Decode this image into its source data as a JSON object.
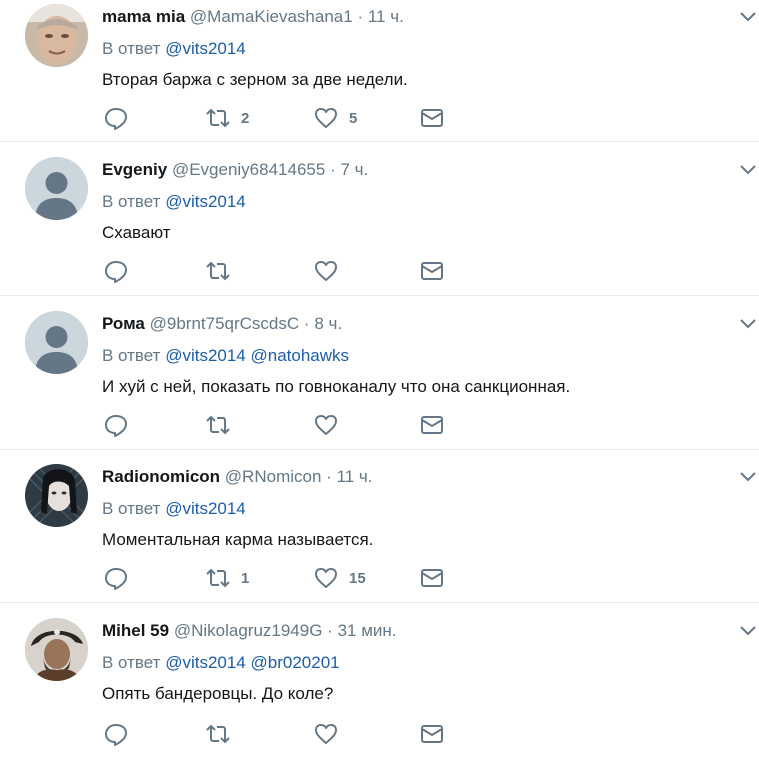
{
  "colors": {
    "name": "#14171a",
    "meta": "#657786",
    "mention": "#1b5ea8",
    "divider": "#e6ecf0",
    "icon": "#657786",
    "avatar_default": "#ccd6dd"
  },
  "tweets": [
    {
      "name": "mama mia",
      "handle": "@MamaKievashana1",
      "dot": "·",
      "time": "11 ч.",
      "reply_prefix": "В ответ",
      "mentions": [
        "@vits2014"
      ],
      "text": "Вторая баржа с зерном за две недели.",
      "retweets": "2",
      "likes": "5",
      "avatar": "photo-man-face"
    },
    {
      "name": "Evgeniy",
      "handle": "@Evgeniy68414655",
      "dot": "·",
      "time": "7 ч.",
      "reply_prefix": "В ответ",
      "mentions": [
        "@vits2014"
      ],
      "text": "Схавают",
      "retweets": "",
      "likes": "",
      "avatar": "default-person"
    },
    {
      "name": "Рома",
      "handle": "@9brnt75qrCscdsC",
      "dot": "·",
      "time": "8 ч.",
      "reply_prefix": "В ответ",
      "mentions": [
        "@vits2014",
        "@natohawks"
      ],
      "text": "И хуй с ней, показать по говноканалу что она санкционная.",
      "retweets": "",
      "likes": "",
      "avatar": "default-person"
    },
    {
      "name": "Radionomicon",
      "handle": "@RNomicon",
      "dot": "·",
      "time": "11 ч.",
      "reply_prefix": "В ответ",
      "mentions": [
        "@vits2014"
      ],
      "text": "Моментальная карма называется.",
      "retweets": "1",
      "likes": "15",
      "avatar": "photo-dark-hair"
    },
    {
      "name": "Mihel 59",
      "handle": "@Nikolagruz1949G",
      "dot": "·",
      "time": "31 мин.",
      "reply_prefix": "В ответ",
      "mentions": [
        "@vits2014",
        "@br020201"
      ],
      "text": "Опять бандеровцы. До коле?",
      "retweets": "",
      "likes": "",
      "avatar": "photo-pirate"
    }
  ],
  "icons": {
    "reply": "reply-bubble-icon",
    "retweet": "retweet-arrows-icon",
    "like": "heart-icon",
    "dm": "envelope-icon",
    "more": "chevron-down-icon"
  }
}
